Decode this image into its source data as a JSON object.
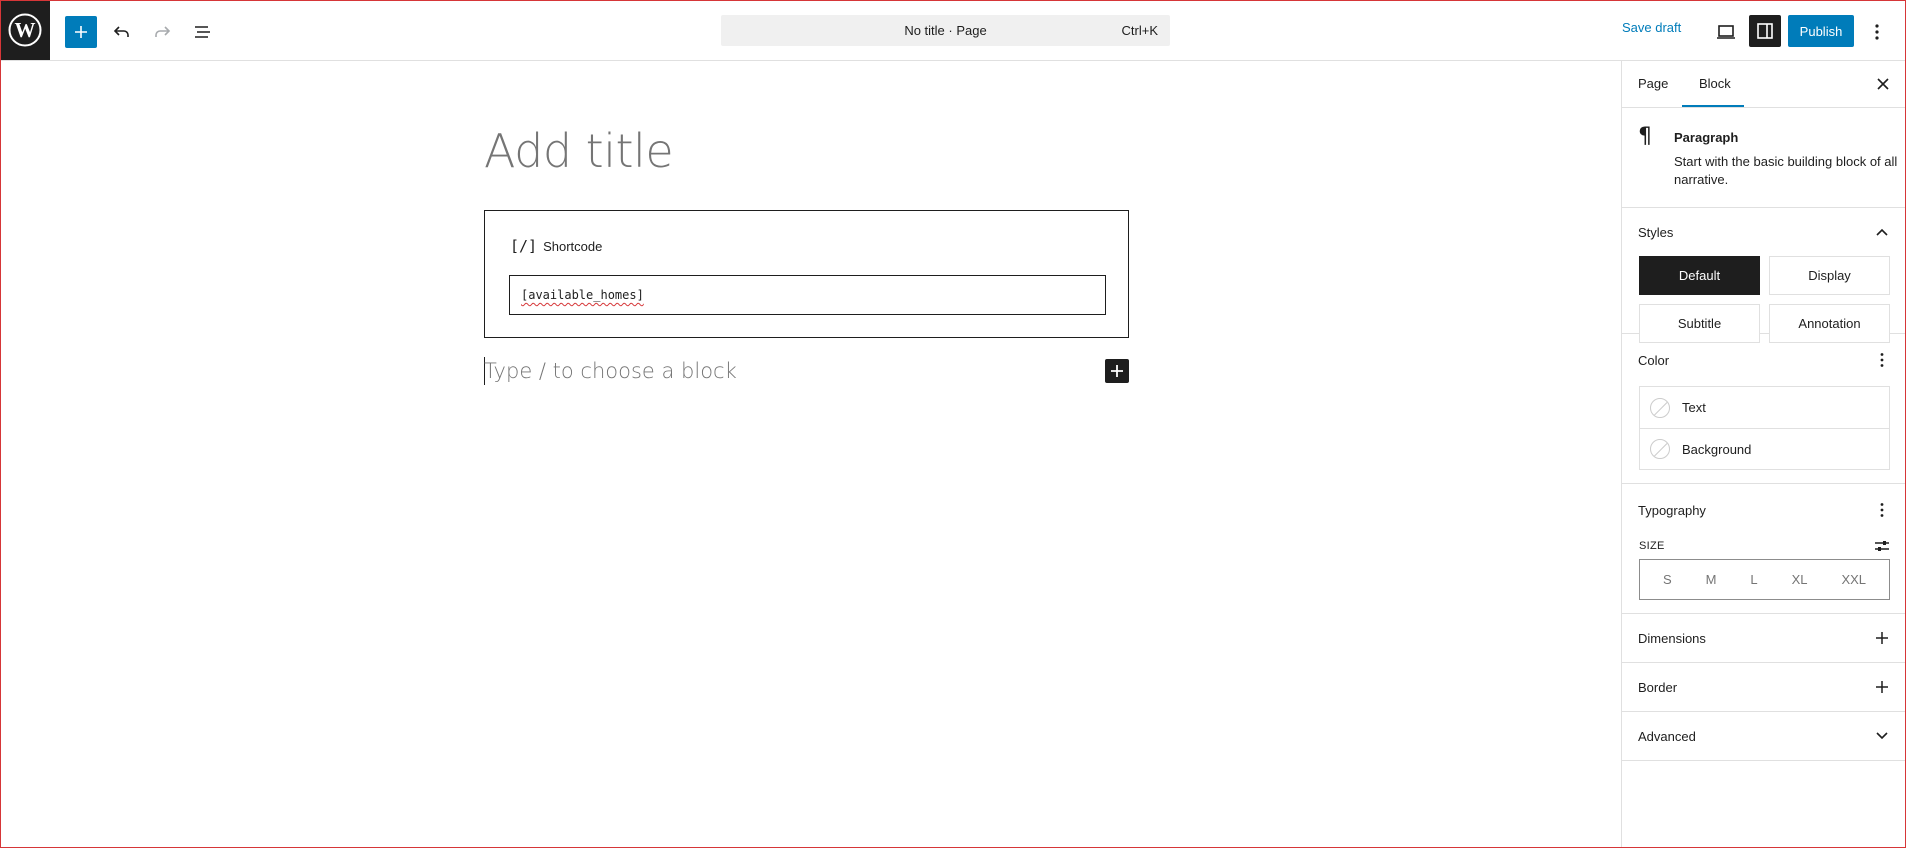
{
  "toolbar": {
    "doc_title": "No title · Page",
    "shortcut": "Ctrl+K",
    "save_draft": "Save draft",
    "publish": "Publish"
  },
  "editor": {
    "title_placeholder": "Add title",
    "shortcode_label": "Shortcode",
    "shortcode_glyph": "[/]",
    "shortcode_value": "[available_homes]",
    "block_placeholder": "Type / to choose a block"
  },
  "sidebar": {
    "tabs": [
      "Page",
      "Block"
    ],
    "block_name": "Paragraph",
    "block_description": "Start with the basic building block of all narrative.",
    "styles": {
      "title": "Styles",
      "options": [
        "Default",
        "Display",
        "Subtitle",
        "Annotation"
      ],
      "active": "Default"
    },
    "color": {
      "title": "Color",
      "items": [
        "Text",
        "Background"
      ]
    },
    "typography": {
      "title": "Typography",
      "size_label": "SIZE",
      "sizes": [
        "S",
        "M",
        "L",
        "XL",
        "XXL"
      ]
    },
    "dimensions": "Dimensions",
    "border": "Border",
    "advanced": "Advanced"
  },
  "colors": {
    "accent": "#007cba",
    "dark": "#1e1e1e",
    "placeholder": "#757575",
    "border": "#e0e0e0",
    "frame": "#d63638"
  }
}
